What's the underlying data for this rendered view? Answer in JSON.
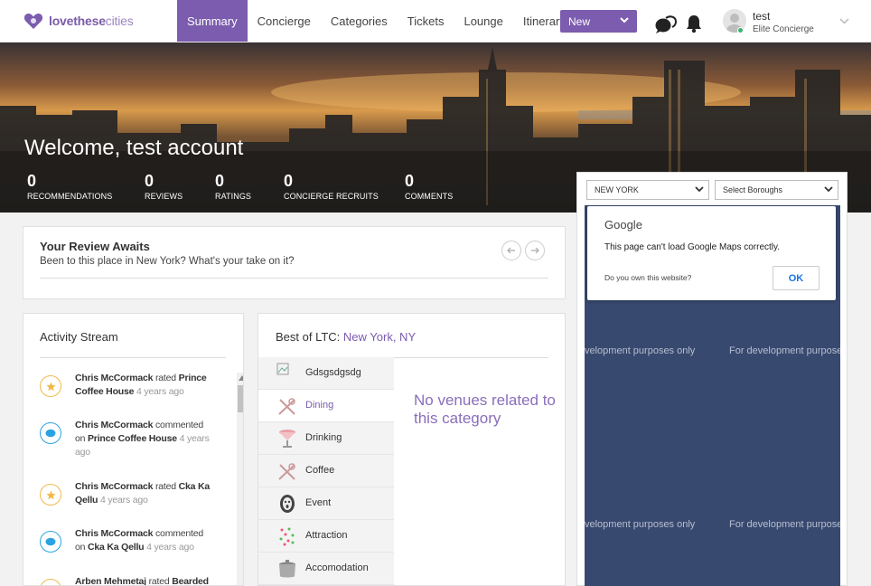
{
  "brand": {
    "name_bold": "lovethese",
    "name_light": "cities",
    "color": "#7b5cae"
  },
  "nav": {
    "items": [
      {
        "label": "Summary",
        "active": true
      },
      {
        "label": "Concierge"
      },
      {
        "label": "Categories"
      },
      {
        "label": "Tickets"
      },
      {
        "label": "Lounge"
      },
      {
        "label": "Itinerary"
      }
    ],
    "new_button": "New"
  },
  "user": {
    "name": "test",
    "role": "Elite Concierge",
    "status_color": "#3cb371"
  },
  "hero": {
    "welcome": "Welcome, test account",
    "stats": [
      {
        "value": "0",
        "label": "RECOMMENDATIONS"
      },
      {
        "value": "0",
        "label": "REVIEWS"
      },
      {
        "value": "0",
        "label": "RATINGS"
      },
      {
        "value": "0",
        "label": "CONCIERGE RECRUITS"
      },
      {
        "value": "0",
        "label": "COMMENTS"
      }
    ]
  },
  "map": {
    "city_select": "NEW YORK",
    "borough_select": "Select Boroughs",
    "dev_text": "For development purposes only",
    "dev_text_cut": "velopment purposes only",
    "dialog": {
      "title": "Google",
      "message": "This page can't load Google Maps correctly.",
      "own": "Do you own this website?",
      "ok": "OK"
    }
  },
  "review": {
    "title": "Your Review Awaits",
    "subtitle": "Been to this place in New York? What's your take on it?"
  },
  "activity": {
    "title": "Activity Stream",
    "items": [
      {
        "type": "star",
        "user": "Chris McCormack",
        "action": "rated",
        "target": "Prince Coffee House",
        "ago": "4 years ago"
      },
      {
        "type": "comment",
        "user": "Chris McCormack",
        "action": "commented on",
        "target": "Prince Coffee House",
        "ago": "4 years ago"
      },
      {
        "type": "star",
        "user": "Chris McCormack",
        "action": "rated",
        "target": "Cka Ka Qellu",
        "ago": "4 years ago"
      },
      {
        "type": "comment",
        "user": "Chris McCormack",
        "action": "commented on",
        "target": "Cka Ka Qellu",
        "ago": "4 years ago"
      },
      {
        "type": "star",
        "user": "Arben Mehmetaj",
        "action": "rated",
        "target": "Bearded",
        "ago": ""
      }
    ]
  },
  "bestof": {
    "prefix": "Best of LTC: ",
    "city": "New York, NY",
    "categories": [
      {
        "label": "Gdsgsdgsdg",
        "icon": "broken-image-icon"
      },
      {
        "label": "Dining",
        "icon": "utensils-icon",
        "active": true
      },
      {
        "label": "Drinking",
        "icon": "cocktail-icon"
      },
      {
        "label": "Coffee",
        "icon": "utensils-icon"
      },
      {
        "label": "Event",
        "icon": "mask-icon"
      },
      {
        "label": "Attraction",
        "icon": "confetti-icon"
      },
      {
        "label": "Accomodation",
        "icon": "pot-icon"
      }
    ],
    "empty_message": "No venues related to this category"
  }
}
